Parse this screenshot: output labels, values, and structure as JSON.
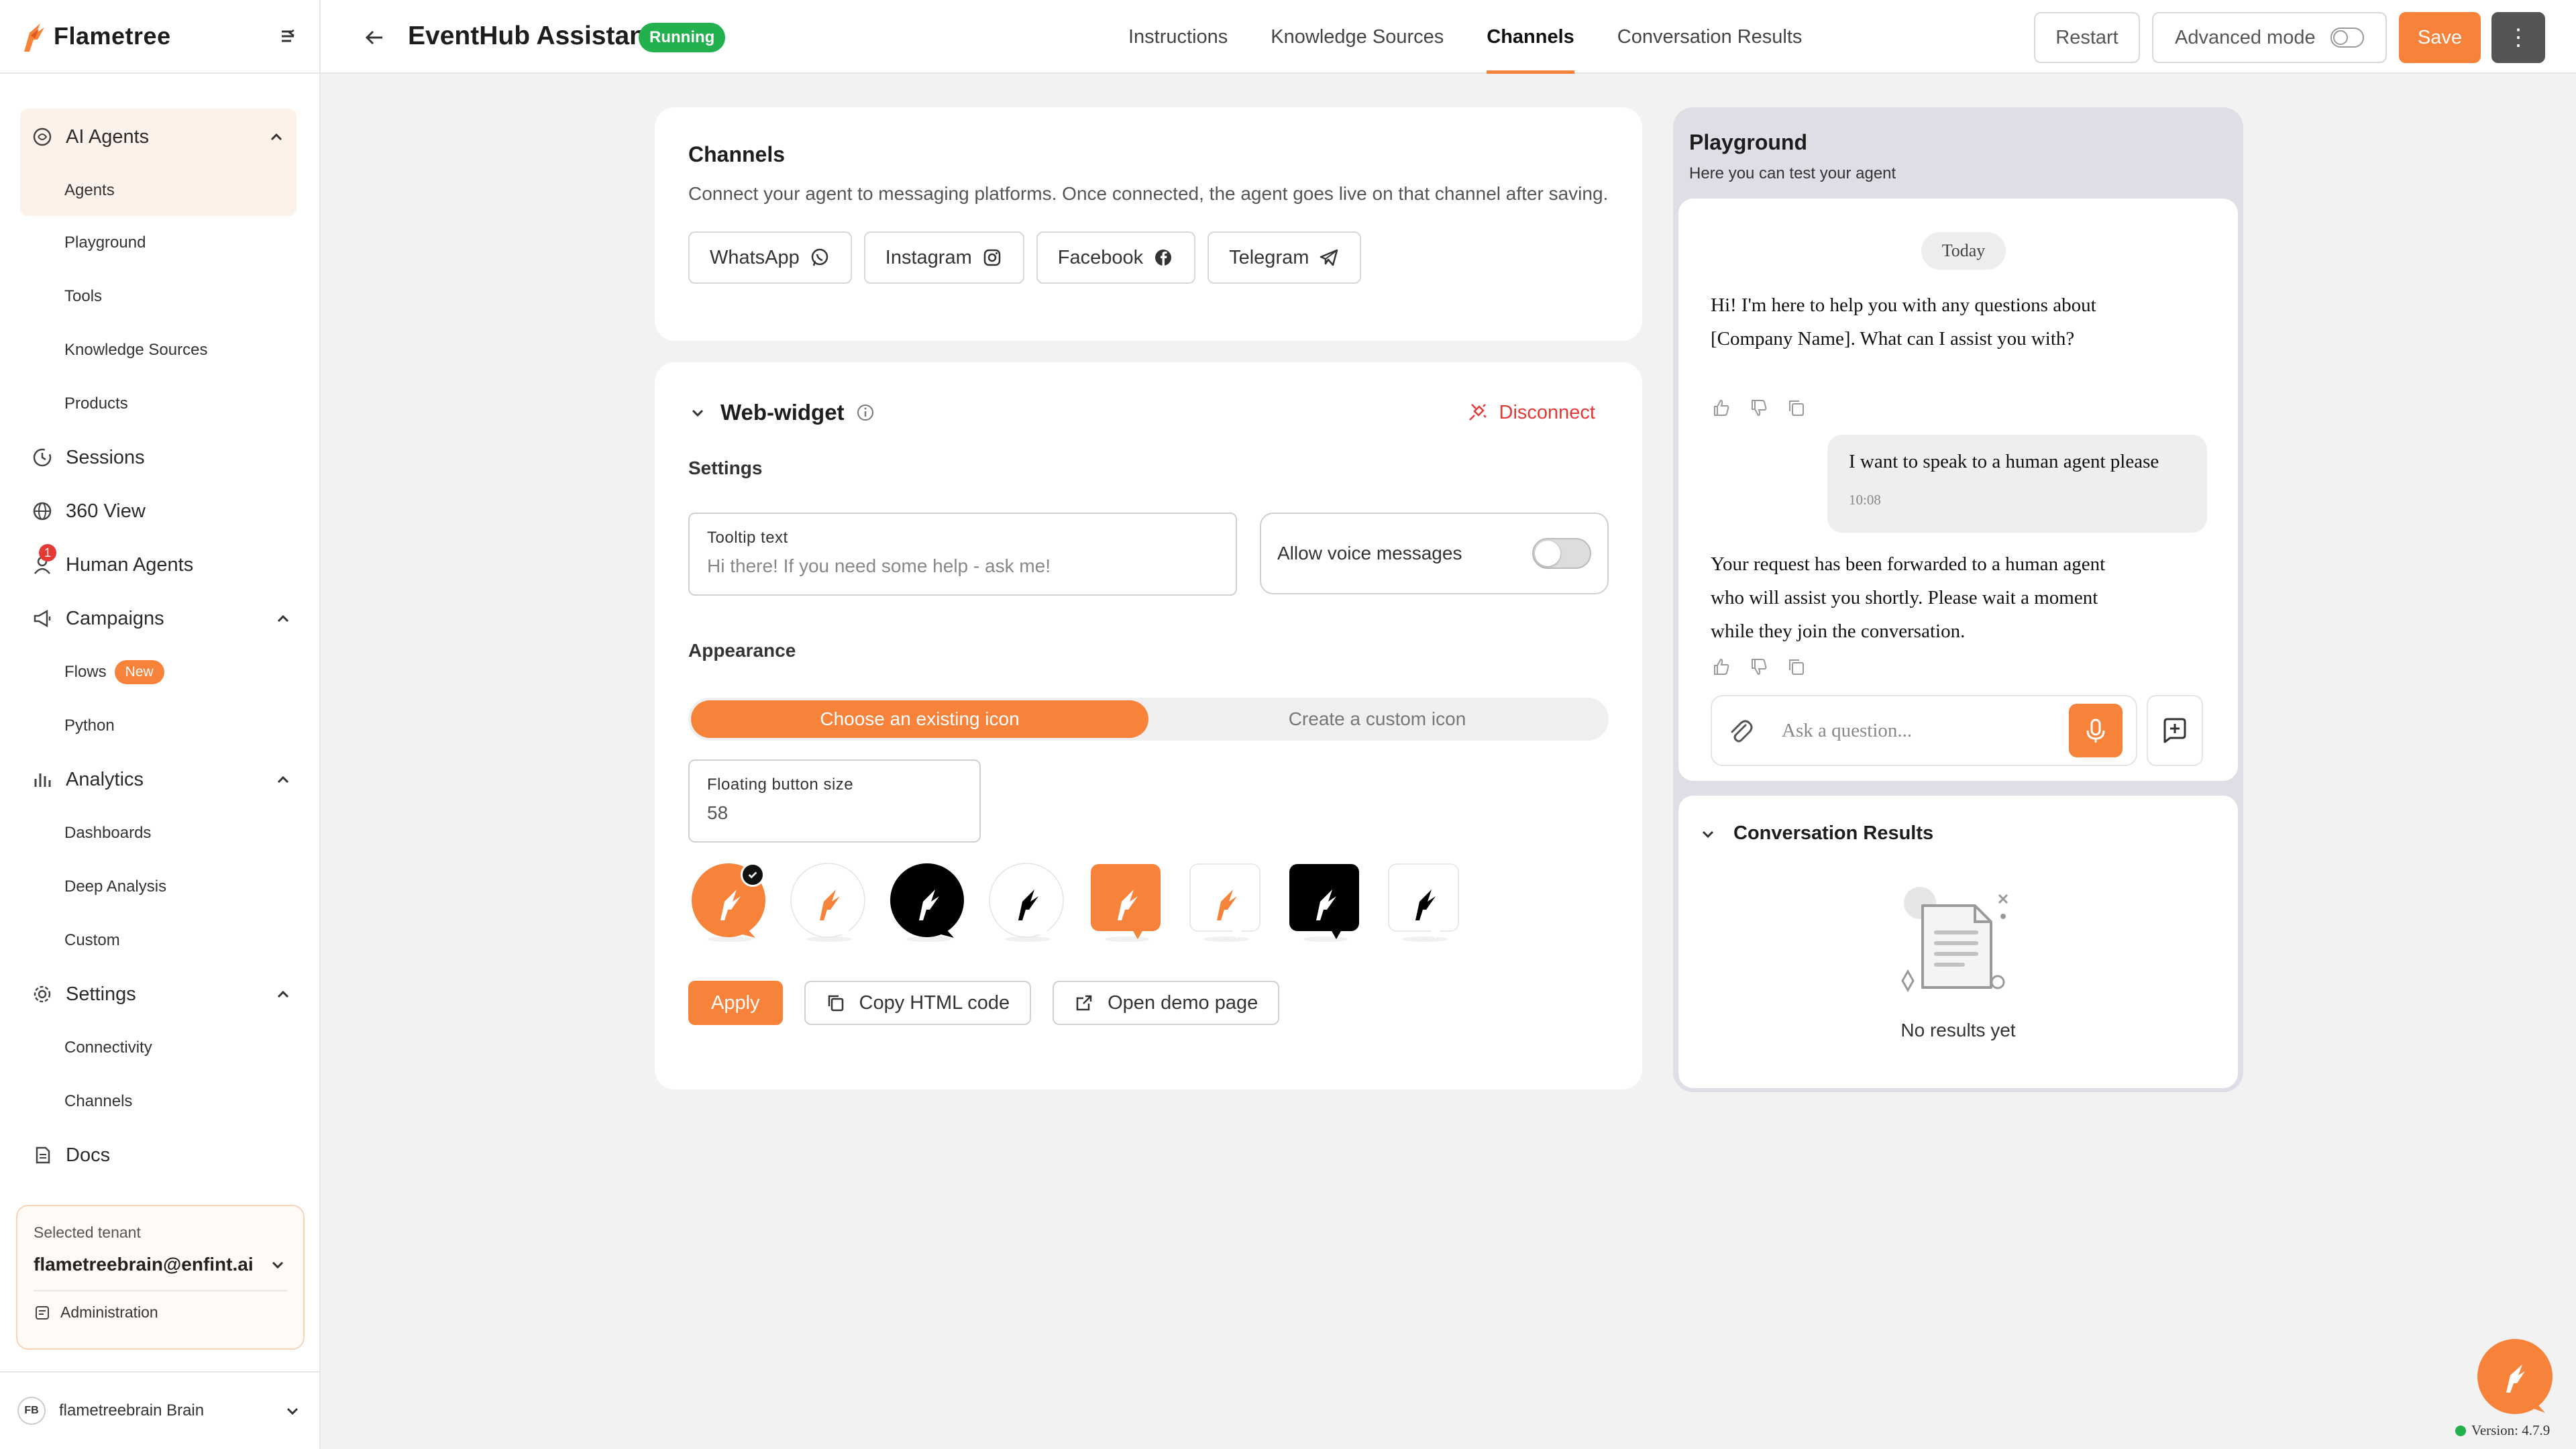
{
  "brand": {
    "name": "Flametree",
    "accent": "#f7823a"
  },
  "sidebar": {
    "groups": [
      {
        "label": "AI Agents",
        "icon": "brain-icon",
        "expanded": true,
        "items": [
          {
            "label": "Agents",
            "active": true
          },
          {
            "label": "Playground"
          },
          {
            "label": "Tools"
          },
          {
            "label": "Knowledge Sources"
          },
          {
            "label": "Products"
          }
        ]
      },
      {
        "label": "Sessions",
        "icon": "history-icon"
      },
      {
        "label": "360 View",
        "icon": "globe-icon"
      },
      {
        "label": "Human Agents",
        "icon": "user-icon",
        "badge": "1"
      },
      {
        "label": "Campaigns",
        "icon": "megaphone-icon",
        "expanded": true,
        "items": [
          {
            "label": "Flows",
            "badge": "New"
          },
          {
            "label": "Python"
          }
        ]
      },
      {
        "label": "Analytics",
        "icon": "bar-chart-icon",
        "expanded": true,
        "items": [
          {
            "label": "Dashboards"
          },
          {
            "label": "Deep Analysis"
          },
          {
            "label": "Custom"
          }
        ]
      },
      {
        "label": "Settings",
        "icon": "gear-icon",
        "expanded": true,
        "items": [
          {
            "label": "Connectivity"
          },
          {
            "label": "Channels"
          }
        ]
      },
      {
        "label": "Docs",
        "icon": "docs-icon"
      }
    ],
    "tenant": {
      "label": "Selected tenant",
      "value": "flametreebrain@enfint.ai",
      "admin_label": "Administration"
    },
    "brain": {
      "initials": "FB",
      "name": "flametreebrain Brain"
    }
  },
  "header": {
    "title": "EventHub Assistant",
    "status": "Running",
    "tabs": [
      {
        "label": "Instructions"
      },
      {
        "label": "Knowledge Sources"
      },
      {
        "label": "Channels",
        "active": true
      },
      {
        "label": "Conversation Results"
      }
    ],
    "restart_label": "Restart",
    "advanced_label": "Advanced mode",
    "save_label": "Save",
    "more_label": "⋮"
  },
  "channels": {
    "title": "Channels",
    "description": "Connect your agent to messaging platforms. Once connected, the agent goes live on that channel after saving.",
    "buttons": [
      {
        "label": "WhatsApp",
        "icon": "whatsapp-icon"
      },
      {
        "label": "Instagram",
        "icon": "instagram-icon"
      },
      {
        "label": "Facebook",
        "icon": "facebook-icon"
      },
      {
        "label": "Telegram",
        "icon": "telegram-icon"
      }
    ]
  },
  "widget": {
    "title": "Web-widget",
    "disconnect_label": "Disconnect",
    "settings_label": "Settings",
    "tooltip_label": "Tooltip text",
    "tooltip_value": "Hi there! If you need some help - ask me!",
    "voice_label": "Allow voice messages",
    "voice_enabled": false,
    "appearance_label": "Appearance",
    "segment_existing": "Choose an existing icon",
    "segment_custom": "Create a custom icon",
    "size_label": "Floating button size",
    "size_value": "58",
    "icon_options": [
      {
        "style": "orange-bubble",
        "bg": "#f7823a",
        "fg": "#ffffff",
        "shape": "bubble",
        "selected": true
      },
      {
        "style": "white-bubble-orange",
        "bg": "#ffffff",
        "fg": "#f7823a",
        "shape": "bubble"
      },
      {
        "style": "black-bubble",
        "bg": "#000000",
        "fg": "#ffffff",
        "shape": "bubble"
      },
      {
        "style": "white-bubble-black",
        "bg": "#ffffff",
        "fg": "#000000",
        "shape": "bubble"
      },
      {
        "style": "orange-square",
        "bg": "#f7823a",
        "fg": "#ffffff",
        "shape": "square"
      },
      {
        "style": "white-square-orange",
        "bg": "#ffffff",
        "fg": "#f7823a",
        "shape": "square"
      },
      {
        "style": "black-square",
        "bg": "#000000",
        "fg": "#ffffff",
        "shape": "square"
      },
      {
        "style": "white-square-black",
        "bg": "#ffffff",
        "fg": "#000000",
        "shape": "square"
      }
    ],
    "apply_label": "Apply",
    "copy_label": "Copy HTML code",
    "demo_label": "Open demo page"
  },
  "playground": {
    "title": "Playground",
    "subtitle": "Here you can test your agent",
    "date_pill": "Today",
    "messages": [
      {
        "from": "bot",
        "text": "Hi! I'm here to help you with any questions about [Company Name]. What can I assist you with?"
      },
      {
        "from": "user",
        "text": "I want to speak to a human agent please",
        "time": "10:08"
      },
      {
        "from": "bot",
        "text": "Your request has been forwarded to a human agent who will assist you shortly. Please wait a moment while they join the conversation."
      }
    ],
    "input_placeholder": "Ask a question..."
  },
  "results": {
    "title": "Conversation Results",
    "empty_text": "No results yet"
  },
  "version": "Version: 4.7.9"
}
